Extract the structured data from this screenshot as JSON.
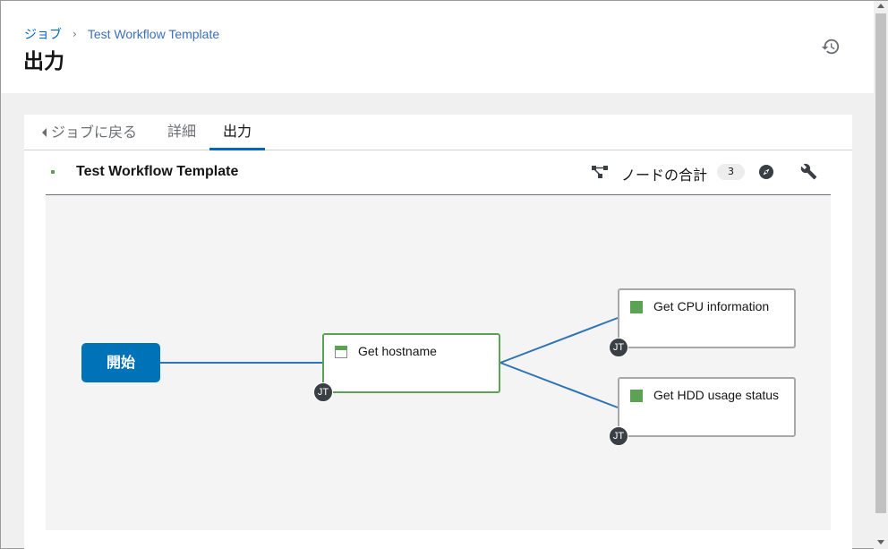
{
  "breadcrumb": {
    "parent": "ジョブ",
    "separator": "›",
    "current": "Test Workflow Template"
  },
  "page_title": "出力",
  "tabs": {
    "back": "ジョブに戻る",
    "details": "詳細",
    "output": "出力",
    "active": "output"
  },
  "workflow": {
    "title": "Test Workflow Template",
    "node_total_label": "ノードの合計",
    "node_count": "3",
    "start_label": "開始",
    "nodes": [
      {
        "label": "Get hostname",
        "badge": "JT",
        "status": "running"
      },
      {
        "label": "Get CPU information",
        "badge": "JT",
        "status": "successful"
      },
      {
        "label": "Get HDD usage status",
        "badge": "JT",
        "status": "successful"
      }
    ]
  },
  "icons": {
    "history": "history-icon",
    "topology": "topology-icon",
    "compass": "compass-icon",
    "wrench": "wrench-icon"
  },
  "colors": {
    "accent": "#0066cc",
    "start_node": "#0073b8",
    "success": "#5ba352",
    "link": "#2f74b5"
  }
}
